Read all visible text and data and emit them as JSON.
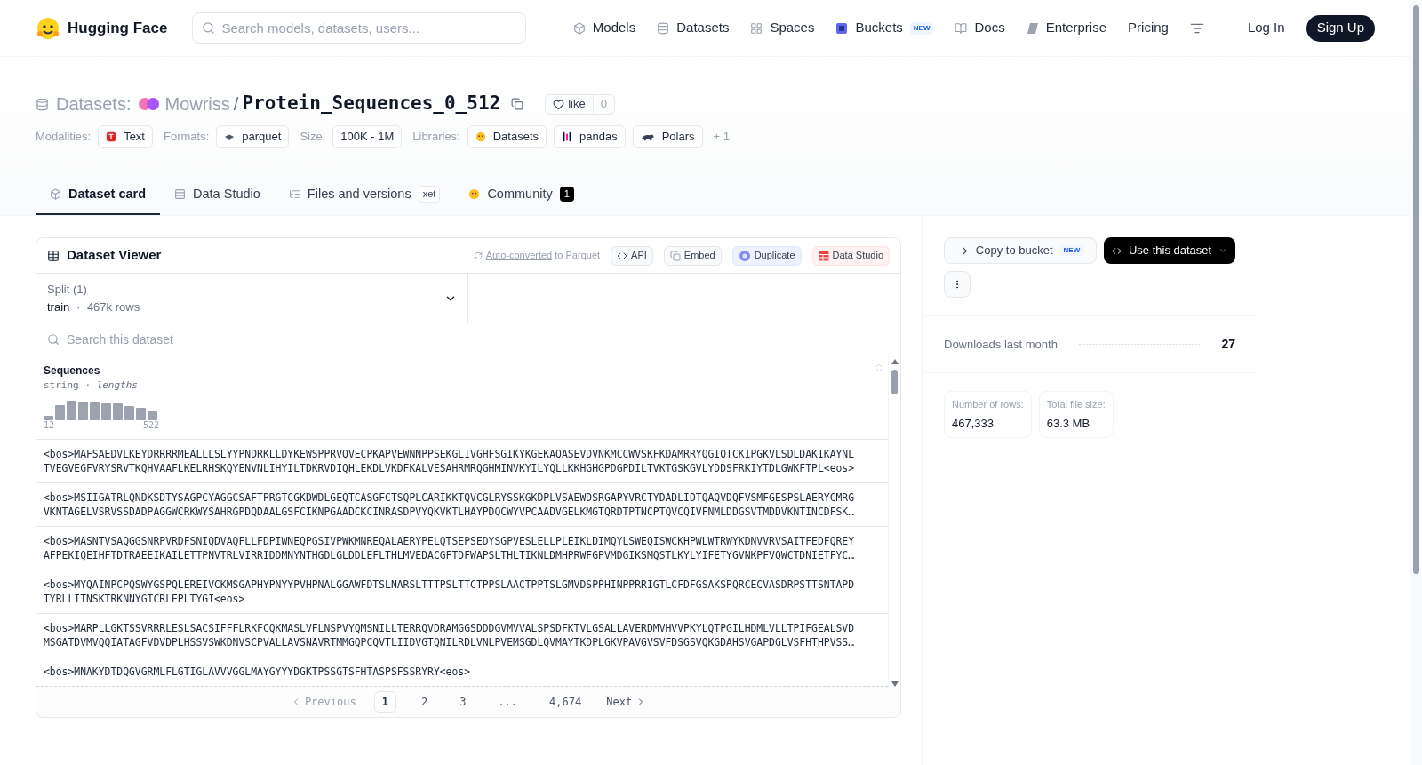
{
  "header": {
    "brand": "Hugging Face",
    "search_placeholder": "Search models, datasets, users...",
    "nav": [
      {
        "label": "Models"
      },
      {
        "label": "Datasets"
      },
      {
        "label": "Spaces"
      },
      {
        "label": "Buckets",
        "badge": "NEW"
      },
      {
        "label": "Docs"
      },
      {
        "label": "Enterprise"
      },
      {
        "label": "Pricing"
      }
    ],
    "login": "Log In",
    "signup": "Sign Up"
  },
  "title": {
    "prefix": "Datasets:",
    "owner": "Mowriss",
    "separator": "/",
    "name": "Protein_Sequences_0_512",
    "like": "like",
    "likes": "0"
  },
  "tags": [
    {
      "label": "Modalities:",
      "items": [
        {
          "label": "Text"
        }
      ]
    },
    {
      "label": "Formats:",
      "items": [
        {
          "label": "parquet"
        }
      ]
    },
    {
      "label": "Size:",
      "items": [
        {
          "label": "100K - 1M"
        }
      ]
    },
    {
      "label": "Libraries:",
      "items": [
        {
          "label": "Datasets"
        },
        {
          "label": "pandas"
        },
        {
          "label": "Polars"
        }
      ]
    }
  ],
  "tags_more": "+ 1",
  "tabs": [
    {
      "label": "Dataset card",
      "selected": true
    },
    {
      "label": "Data Studio",
      "selected": false
    },
    {
      "label": "Files and versions",
      "badge": "xet",
      "selected": false
    },
    {
      "label": "Community",
      "count": "1",
      "selected": false
    }
  ],
  "viewer": {
    "title": "Dataset Viewer",
    "converted_link": "Auto-converted",
    "converted_suffix": "to Parquet",
    "actions": [
      {
        "label": "API",
        "kind": "api"
      },
      {
        "label": "Embed",
        "kind": "embed"
      },
      {
        "label": "Duplicate",
        "kind": "duplicate"
      },
      {
        "label": "Data Studio",
        "kind": "studio"
      }
    ],
    "split": {
      "label": "Split (1)",
      "value": "train",
      "separator": "·",
      "rows": "467k rows"
    },
    "search_placeholder": "Search this dataset",
    "column": {
      "name": "Sequences",
      "type": "string",
      "separator": "·",
      "stat": "lengths",
      "min": "12",
      "max": "522"
    },
    "rows": [
      {
        "lines": [
          "<bos>MAFSAEDVLKEYDRRRRMEALLLSLYYPNDRKLLDYKEWSPPRVQVECPKAPVEWNNPPSEKGLIVGHFSGIKYKGEKAQASEVDVNKMCCWVSKFKDAMRRYQGIQTCKIPGKVLSDLDAKIKAYNL",
          "TVEGVEGFVRYSRVTKQHVAAFLKELRHSKQYENVNLIHYILTDKRVDIQHLEKDLVKDFKALVESAHRMRQGHMINVKYILYQLLKKHGHGPDGPDILTVKTGSKGVLYDDSFRKIYTDLGWKFTPL<eos>"
        ]
      },
      {
        "lines": [
          "<bos>MSIIGATRLQNDKSDTYSAGPCYAGGCSAFTPRGTCGKDWDLGEQTCASGFCTSQPLCARIKKTQVCGLRYSSKGKDPLVSAEWDSRGAPYVRCTYDADLIDTQAQVDQFVSMFGESPSLAERYCMRG",
          "VKNTAGELVSRVSSDADPAGGWCRKWYSAHRGPDQDAALGSFCIKNPGAADCKCINRASDPVYQKVKTLHAYPDQCWYVPCAADVGELKMGTQRDTPTNCPTQVCQIVFNMLDDGSVTMDDVKNTINCDFSK…"
        ]
      },
      {
        "lines": [
          "<bos>MASNTVSAQGGSNRPVRDFSNIQDVAQFLLFDPIWNEQPGSIVPWKMNREQALAERYPELQTSEPSEDYSGPVESLELLPLEIKLDIMQYLSWEQISWCKHPWLWTRWYKDNVVRVSAITFEDFQREY",
          "AFPEKIQEIHFTDTRAEEIKAILETTPNVTRLVIRRIDDMNYNTHGDLGLDDLEFLTHLMVEDACGFTDFWAPSLTHLTIKNLDMHPRWFGPVMDGIKSMQSTLKYLYIFETYGVNKPFVQWCTDNIETFYC…"
        ]
      },
      {
        "lines": [
          "<bos>MYQAINPCPQSWYGSPQLEREIVCKMSGAPHYPNYYPVHPNALGGAWFDTSLNARSLTTTPSLTTCTPPSLAACTPPTSLGMVDSPPHINPPRRIGTLCFDFGSAKSPQRCECVASDRPSTTSNTAPD",
          "TYRLLITNSKTRKNNYGTCRLEPLTYGI<eos>"
        ]
      },
      {
        "lines": [
          "<bos>MARPLLGKTSSVRRRLESLSACSIFFFLRKFCQKMASLVFLNSPVYQMSNILLTERRQVDRAMGGSDDDGVMVVALSPSDFKTVLGSALLAVERDMVHVVPKYLQTPGILHDMLVLLTPIFGEALSVD",
          "MSGATDVMVQQIATAGFVDVDPLHSSVSWKDNVSCPVALLAVSNAVRTMMGQPCQVTLIIDVGTQNILRDLVNLPVEMSGDLQVMAYTKDPLGKVPAVGVSVFDSGSVQKGDAHSVGAPDGLVSFHTHPVSS…"
        ]
      },
      {
        "lines": [
          "<bos>MNAKYDTDQGVGRMLFLGTIGLAVVVGGLMAYGYYYDGKTPSSGTSFHTASPSFSSRYRY<eos>"
        ]
      }
    ],
    "pagination": {
      "previous": "Previous",
      "next": "Next",
      "pages": [
        {
          "label": "1",
          "selected": true
        },
        {
          "label": "2",
          "selected": false
        },
        {
          "label": "3",
          "selected": false
        },
        {
          "label": "...",
          "selected": false
        },
        {
          "label": "4,674",
          "selected": false
        }
      ]
    }
  },
  "sidebar": {
    "copy": {
      "label": "Copy to bucket",
      "badge": "NEW"
    },
    "use": "Use this dataset",
    "downloads": {
      "label": "Downloads last month",
      "value": "27"
    },
    "stats": [
      {
        "label": "Number of rows:",
        "value": "467,333"
      },
      {
        "label": "Total file size:",
        "value": "63.3 MB"
      }
    ]
  }
}
